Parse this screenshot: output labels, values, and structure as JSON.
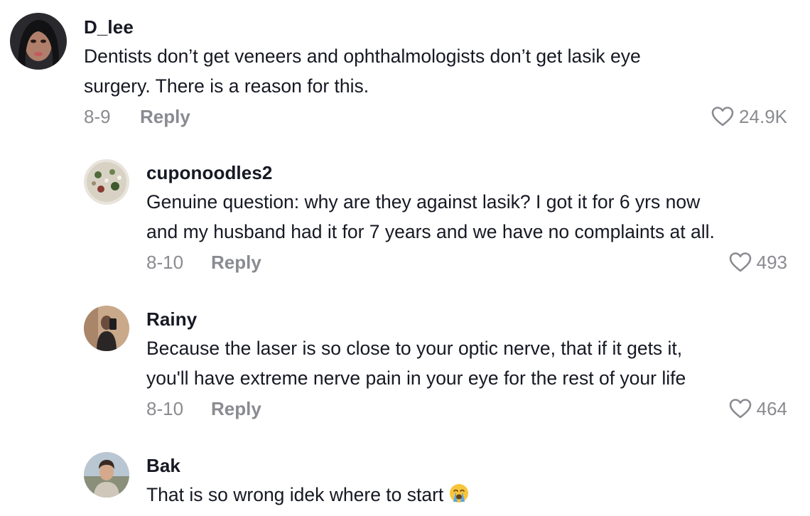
{
  "comments": [
    {
      "username": "D_lee",
      "text_line1": "Dentists don’t get veneers and ophthalmologists don’t get lasik eye",
      "text_line2": "surgery. There is a reason for this.",
      "date": "8-9",
      "reply_label": "Reply",
      "likes": "24.9K",
      "avatar": "avatar-woman-dark-hair"
    },
    {
      "username": "cuponoodles2",
      "text_line1": "Genuine question: why are they against lasik? I got it for 6 yrs now",
      "text_line2": "and my husband had it for 7 years and we have no complaints at all.",
      "date": "8-10",
      "reply_label": "Reply",
      "likes": "493",
      "avatar": "avatar-food-plate"
    },
    {
      "username": "Rainy",
      "text_line1": "Because the laser is so close to your optic nerve, that if it gets it,",
      "text_line2": "you'll have extreme nerve pain in your eye for the rest of your life",
      "date": "8-10",
      "reply_label": "Reply",
      "likes": "464",
      "avatar": "avatar-mirror-selfie"
    },
    {
      "username": "Bak",
      "text_line1": "That is so wrong idek where to start",
      "emoji": "loudly-crying-face-emoji",
      "avatar": "avatar-man-outdoors"
    }
  ],
  "colors": {
    "text": "#161823",
    "secondary": "#8a8b91",
    "background": "#ffffff"
  },
  "icons": {
    "like": "heart-outline-icon"
  }
}
